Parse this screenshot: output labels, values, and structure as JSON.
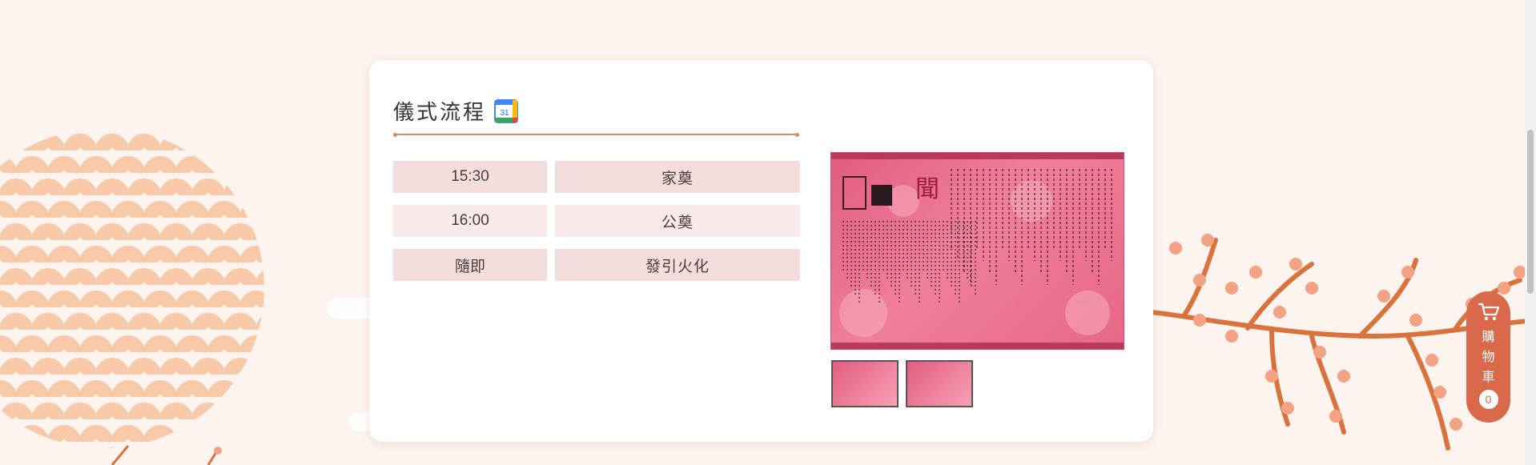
{
  "section": {
    "title": "儀式流程",
    "calendar_icon_text": "31"
  },
  "schedule": [
    {
      "time": "15:30",
      "event": "家奠"
    },
    {
      "time": "16:00",
      "event": "公奠"
    },
    {
      "time": "隨即",
      "event": "發引火化"
    }
  ],
  "notice_image": {
    "heading_char": "聞",
    "thumbnails": [
      "thumbnail-1",
      "thumbnail-2"
    ]
  },
  "cart": {
    "label": "購物車",
    "count": "0"
  },
  "colors": {
    "accent": "#d9694a",
    "row_odd": "#f4dedd",
    "row_even": "#f8ebea",
    "divider": "#c8906a",
    "notice_pink": "#e76786"
  }
}
